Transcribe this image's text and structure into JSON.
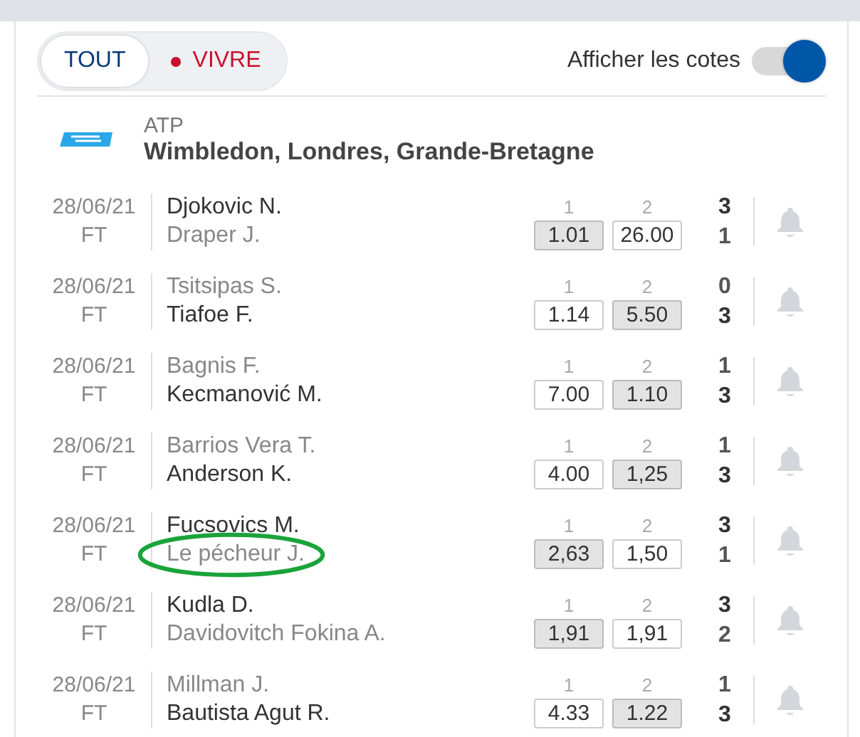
{
  "filter_tabs": [
    {
      "label": "TOUT",
      "selected": true,
      "kind": "plain"
    },
    {
      "label": "VIVRE",
      "selected": false,
      "kind": "live"
    }
  ],
  "odds_toggle": {
    "label": "Afficher les cotes",
    "on": true
  },
  "league": {
    "category": "ATP",
    "name": "Wimbledon, Londres, Grande-Bretagne"
  },
  "matches": [
    {
      "date": "28/06/21",
      "status": "FT",
      "players": [
        {
          "name": "Djokovic N.",
          "score": "3",
          "winner": true,
          "odds_label": "1",
          "odds": "1.01"
        },
        {
          "name": "Draper J.",
          "score": "1",
          "winner": false,
          "odds_label": "2",
          "odds": "26.00"
        }
      ]
    },
    {
      "date": "28/06/21",
      "status": "FT",
      "players": [
        {
          "name": "Tsitsipas S.",
          "score": "0",
          "winner": false,
          "odds_label": "1",
          "odds": "1.14"
        },
        {
          "name": "Tiafoe F.",
          "score": "3",
          "winner": true,
          "odds_label": "2",
          "odds": "5.50"
        }
      ]
    },
    {
      "date": "28/06/21",
      "status": "FT",
      "players": [
        {
          "name": "Bagnis F.",
          "score": "1",
          "winner": false,
          "odds_label": "1",
          "odds": "7.00"
        },
        {
          "name": "Kecmanović M.",
          "score": "3",
          "winner": true,
          "odds_label": "2",
          "odds": "1.10"
        }
      ]
    },
    {
      "date": "28/06/21",
      "status": "FT",
      "players": [
        {
          "name": "Barrios Vera T.",
          "score": "1",
          "winner": false,
          "odds_label": "1",
          "odds": "4.00"
        },
        {
          "name": "Anderson K.",
          "score": "3",
          "winner": true,
          "odds_label": "2",
          "odds": "1,25"
        }
      ]
    },
    {
      "date": "28/06/21",
      "status": "FT",
      "players": [
        {
          "name": "Fucsovics M.",
          "score": "3",
          "winner": true,
          "odds_label": "1",
          "odds": "2,63"
        },
        {
          "name": "Le pécheur J.",
          "score": "1",
          "winner": false,
          "odds_label": "2",
          "odds": "1,50",
          "circled": true
        }
      ]
    },
    {
      "date": "28/06/21",
      "status": "FT",
      "players": [
        {
          "name": "Kudla D.",
          "score": "3",
          "winner": true,
          "odds_label": "1",
          "odds": "1,91"
        },
        {
          "name": "Davidovitch Fokina A.",
          "score": "2",
          "winner": false,
          "odds_label": "2",
          "odds": "1,91"
        }
      ]
    },
    {
      "date": "28/06/21",
      "status": "FT",
      "players": [
        {
          "name": "Millman J.",
          "score": "1",
          "winner": false,
          "odds_label": "1",
          "odds": "4.33"
        },
        {
          "name": "Bautista Agut R.",
          "score": "3",
          "winner": true,
          "odds_label": "2",
          "odds": "1.22"
        }
      ]
    }
  ]
}
